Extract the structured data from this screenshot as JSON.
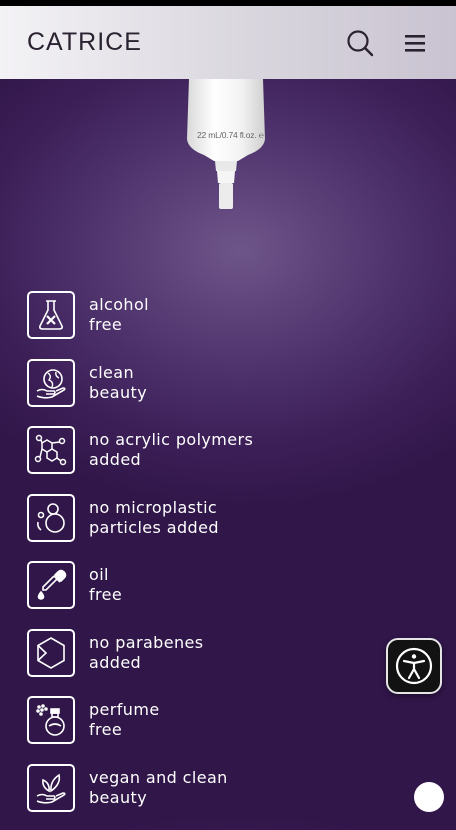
{
  "header": {
    "logo": "CATRICE"
  },
  "product": {
    "size_label": "22 mL/0.74 fl.oz. ℮"
  },
  "features": [
    {
      "line1": "alcohol",
      "line2": "free",
      "icon": "flask-x-icon"
    },
    {
      "line1": "clean",
      "line2": "beauty",
      "icon": "earth-hand-icon"
    },
    {
      "line1": "no acrylic polymers",
      "line2": "added",
      "icon": "molecule-icon"
    },
    {
      "line1": "no microplastic",
      "line2": "particles added",
      "icon": "particles-icon"
    },
    {
      "line1": "oil",
      "line2": "free",
      "icon": "dropper-icon"
    },
    {
      "line1": "no parabenes",
      "line2": "added",
      "icon": "hexagon-icon"
    },
    {
      "line1": "perfume",
      "line2": "free",
      "icon": "perfume-bottle-icon"
    },
    {
      "line1": "vegan and clean",
      "line2": "beauty",
      "icon": "leaf-hand-icon"
    }
  ]
}
